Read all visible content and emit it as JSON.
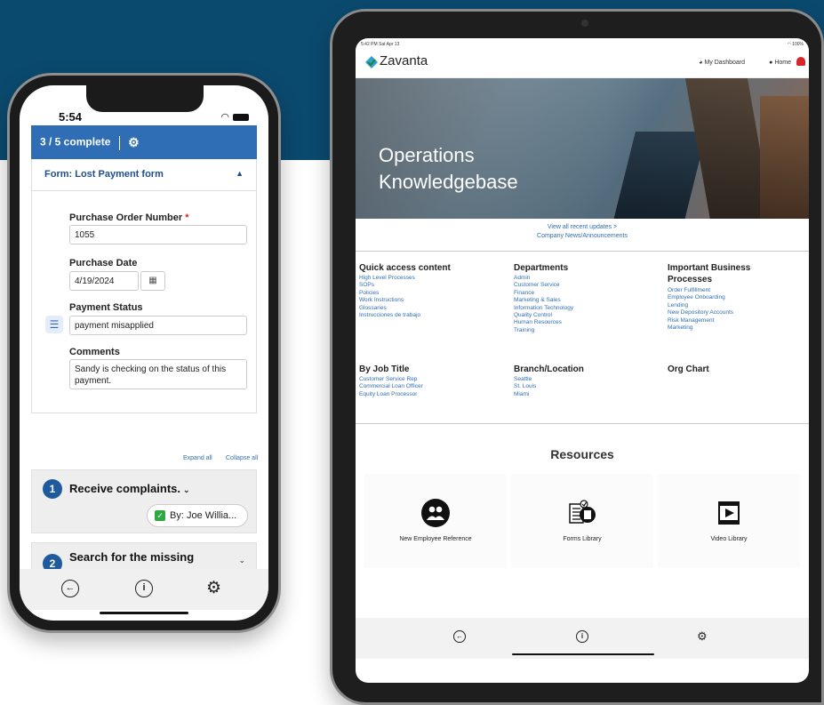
{
  "phone": {
    "time": "5:54",
    "status_icons": "…… ◥",
    "progress": "3 / 5 complete",
    "form_title": "Form: Lost Payment form",
    "fields": {
      "po_label": "Purchase Order Number",
      "po_required_mark": "*",
      "po_value": "1055",
      "date_label": "Purchase Date",
      "date_value": "4/19/2024",
      "status_label": "Payment Status",
      "status_value": "payment misapplied",
      "comments_label": "Comments",
      "comments_value": "Sandy is checking on the status of this payment."
    },
    "expand_all": "Expand all",
    "collapse_all": "Collapse all",
    "steps": [
      {
        "number": "1",
        "title": "Receive complaints.",
        "assignee": "By: Joe Willia..."
      },
      {
        "number": "2",
        "title": "Search for the missing"
      }
    ]
  },
  "tablet": {
    "status_time": "5:42 PM  Sat Apr 13",
    "status_battery": "100%",
    "logo_text": "Zavanta",
    "nav_dashboard": "My Dashboard",
    "nav_home": "Home",
    "hero_title_line1": "Operations",
    "hero_title_line2": "Knowledgebase",
    "recent_updates": "View all recent updates >",
    "company_news": "Company News/Announcements",
    "sections": {
      "quick_access": {
        "title": "Quick access content",
        "links": [
          "High Level Processes",
          "SOPs",
          "Policies",
          "Work Instructions",
          "Glossaries",
          "Instrucciones de trabajo"
        ]
      },
      "departments": {
        "title": "Departments",
        "links": [
          "Admin",
          "Customer Service",
          "Finance",
          "Marketing & Sales",
          "Information Technology",
          "Quality Control",
          "Human Resources",
          "Training"
        ]
      },
      "important": {
        "title_line1": "Important Business",
        "title_line2": "Processes",
        "links": [
          "Order Fulfillment",
          "Employee Onboarding",
          "Lending",
          "New Depository Accounts",
          "Risk Management",
          "Marketing"
        ]
      },
      "job_title": {
        "title": "By Job Title",
        "links": [
          "Customer Service Rep",
          "Commercial Loan Officer",
          "Equity Loan Processor"
        ]
      },
      "branch": {
        "title": "Branch/Location",
        "links": [
          "Seattle",
          "St. Louis",
          "Miami"
        ]
      },
      "org_chart": {
        "title": "Org Chart"
      }
    },
    "resources_title": "Resources",
    "resources": [
      {
        "label": "New Employee Reference",
        "icon": "people-icon"
      },
      {
        "label": "Forms Library",
        "icon": "forms-icon"
      },
      {
        "label": "Video Library",
        "icon": "video-icon"
      }
    ]
  },
  "colors": {
    "brand_blue": "#0b4a6f",
    "accent_blue": "#2f6eb5",
    "required_red": "#d8242b",
    "check_green": "#2fa844"
  }
}
